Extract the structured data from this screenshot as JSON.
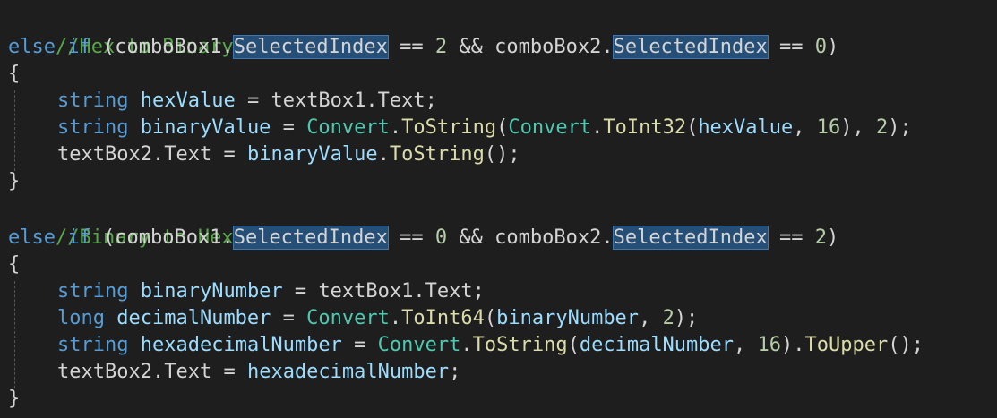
{
  "editor": {
    "comment_hex_to_binary": "//Hex to Binary",
    "comment_binary_to_hex": "//Binary to Hex",
    "kw_else": "else",
    "kw_if": "if",
    "kw_string": "string",
    "kw_long": "long",
    "brace_open": "{",
    "brace_close": "}",
    "combo1": "comboBox1",
    "combo2": "comboBox2",
    "selected_index": "SelectedIndex",
    "textbox1": "textBox1",
    "textbox2": "textBox2",
    "text_prop": "Text",
    "convert": "Convert",
    "to_string": "ToString",
    "to_int32": "ToInt32",
    "to_int64": "ToInt64",
    "to_upper": "ToUpper",
    "var_hex_value": "hexValue",
    "var_binary_value": "binaryValue",
    "var_binary_number": "binaryNumber",
    "var_decimal_number": "decimalNumber",
    "var_hexadecimal_number": "hexadecimalNumber",
    "num_0": "0",
    "num_2": "2",
    "num_16": "16"
  }
}
